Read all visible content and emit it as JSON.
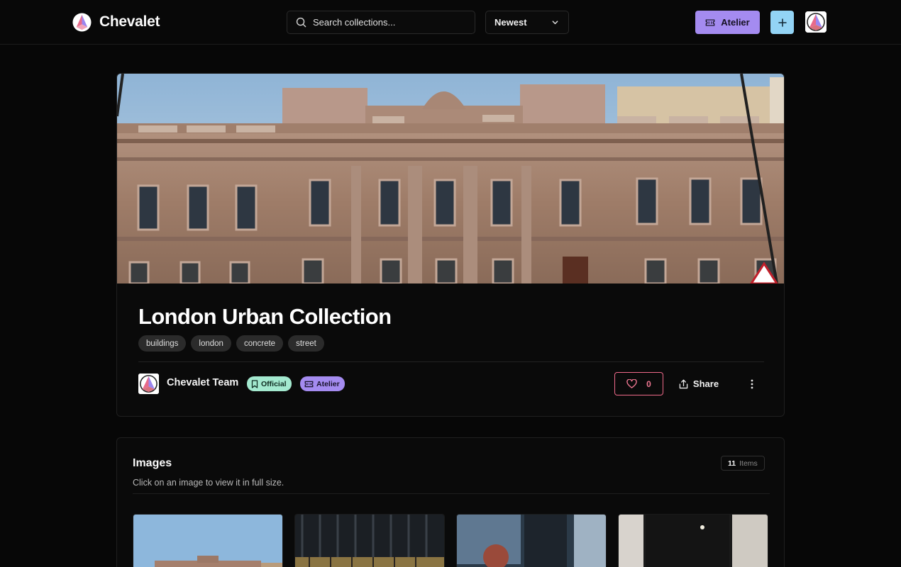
{
  "header": {
    "brand": "Chevalet",
    "search_placeholder": "Search collections...",
    "sort_value": "Newest",
    "atelier_label": "Atelier",
    "icons": [
      "search-icon",
      "chevron-down-icon",
      "ticket-icon",
      "plus-icon"
    ]
  },
  "collection": {
    "title": "London Urban Collection",
    "tags": [
      "buildings",
      "london",
      "concrete",
      "street"
    ],
    "author": "Chevalet Team",
    "badges": {
      "official": "Official",
      "atelier": "Atelier"
    },
    "likes": "0",
    "share_label": "Share"
  },
  "images_section": {
    "title": "Images",
    "subtitle": "Click on an image to view it in full size.",
    "count": "11",
    "count_label": "Items"
  },
  "colors": {
    "background": "#070707",
    "accent_purple": "#a48bf0",
    "accent_blue": "#93d4f5",
    "official_green": "#a3e9cf",
    "like_pink": "#ef6a8a"
  }
}
